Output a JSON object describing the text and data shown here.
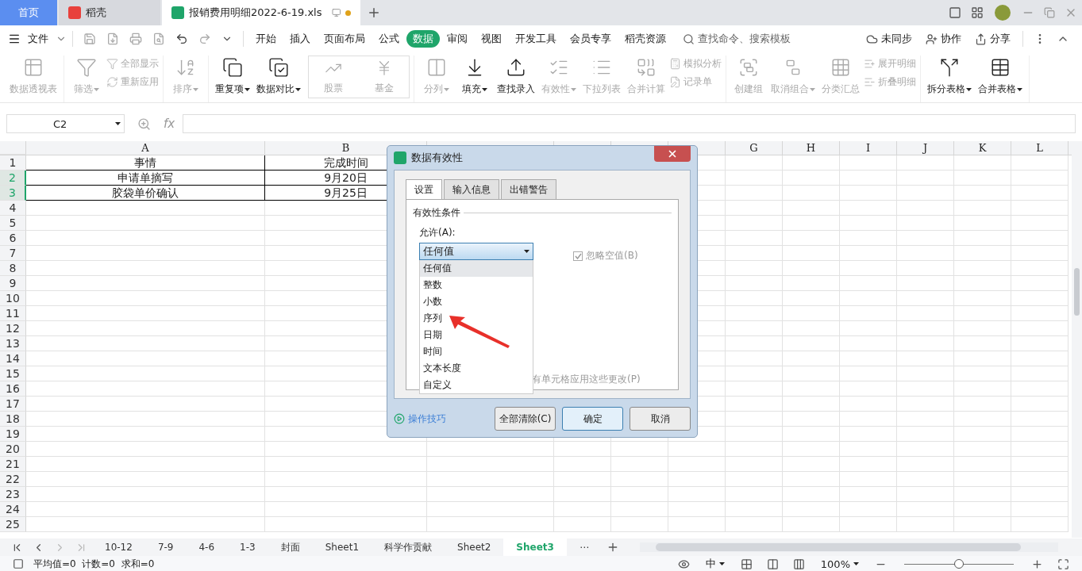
{
  "title_tabs": [
    {
      "label": "首页",
      "kind": "home",
      "selected": false
    },
    {
      "label": "稻壳",
      "kind": "docer",
      "selected": false
    },
    {
      "label": "报销费用明细2022-6-19.xls",
      "kind": "file",
      "selected": true,
      "unsaved": true
    }
  ],
  "menu": {
    "file": "文件",
    "tabs": [
      {
        "label": "开始",
        "selected": false
      },
      {
        "label": "插入",
        "selected": false
      },
      {
        "label": "页面布局",
        "selected": false
      },
      {
        "label": "公式",
        "selected": false
      },
      {
        "label": "数据",
        "selected": true
      },
      {
        "label": "审阅",
        "selected": false
      },
      {
        "label": "视图",
        "selected": false
      },
      {
        "label": "开发工具",
        "selected": false
      },
      {
        "label": "会员专享",
        "selected": false
      },
      {
        "label": "稻壳资源",
        "selected": false
      }
    ],
    "search": {
      "placeholder": "查找命令、搜索模板"
    },
    "actions": [
      "未同步",
      "协作",
      "分享"
    ]
  },
  "ribbon": [
    [
      {
        "kind": "large",
        "label": "数据透视表",
        "disabled": true,
        "dropdown": false
      }
    ],
    [
      {
        "kind": "large",
        "label": "筛选",
        "disabled": true,
        "dropdown": true
      },
      {
        "kind": "small",
        "label": "全部显示",
        "disabled": true
      },
      {
        "kind": "small",
        "label": "重新应用",
        "disabled": true
      }
    ],
    [
      {
        "kind": "large",
        "label": "排序",
        "disabled": true,
        "dropdown": true
      }
    ],
    [
      {
        "kind": "large",
        "label": "重复项",
        "disabled": false,
        "dropdown": true
      },
      {
        "kind": "large",
        "label": "数据对比",
        "disabled": false,
        "dropdown": true
      },
      {
        "kind": "gallery",
        "items": [
          "股票",
          "基金"
        ]
      }
    ],
    [
      {
        "kind": "large",
        "label": "分列",
        "disabled": true,
        "dropdown": true
      },
      {
        "kind": "large",
        "label": "填充",
        "disabled": false,
        "dropdown": true
      },
      {
        "kind": "large",
        "label": "查找录入",
        "disabled": false,
        "dropdown": false
      },
      {
        "kind": "large",
        "label": "有效性",
        "disabled": true,
        "dropdown": true
      },
      {
        "kind": "large",
        "label": "下拉列表",
        "disabled": true,
        "dropdown": false
      },
      {
        "kind": "large",
        "label": "合并计算",
        "disabled": true,
        "dropdown": false
      },
      {
        "kind": "small",
        "label": "模拟分析",
        "disabled": true
      },
      {
        "kind": "small",
        "label": "记录单",
        "disabled": true
      }
    ],
    [
      {
        "kind": "large",
        "label": "创建组",
        "disabled": true,
        "dropdown": false
      },
      {
        "kind": "large",
        "label": "取消组合",
        "disabled": true,
        "dropdown": true
      },
      {
        "kind": "large",
        "label": "分类汇总",
        "disabled": true,
        "dropdown": false
      },
      {
        "kind": "small",
        "label": "展开明细",
        "disabled": true
      },
      {
        "kind": "small",
        "label": "折叠明细",
        "disabled": true
      }
    ],
    [
      {
        "kind": "large",
        "label": "拆分表格",
        "disabled": false,
        "dropdown": true
      },
      {
        "kind": "large",
        "label": "合并表格",
        "disabled": false,
        "dropdown": true
      }
    ]
  ],
  "formula_bar": {
    "name_box": "C2",
    "fx": "fx"
  },
  "columns": [
    {
      "label": "A"
    },
    {
      "label": "B"
    },
    {},
    {},
    {},
    {},
    {
      "label": "G"
    },
    {
      "label": "H"
    },
    {
      "label": "I"
    },
    {
      "label": "J"
    },
    {
      "label": "K"
    },
    {
      "label": "L"
    }
  ],
  "rows": [
    {
      "number": "1",
      "selected": false,
      "cells": [
        "事情",
        "完成时间"
      ]
    },
    {
      "number": "2",
      "selected": true,
      "cells": [
        "申请单摘写",
        "9月20日"
      ]
    },
    {
      "number": "3",
      "selected": true,
      "cells": [
        "胶袋单价确认",
        "9月25日"
      ]
    },
    {
      "number": "4",
      "selected": false
    },
    {
      "number": "5",
      "selected": false
    },
    {
      "number": "6",
      "selected": false
    },
    {
      "number": "7",
      "selected": false
    },
    {
      "number": "8",
      "selected": false
    },
    {
      "number": "9",
      "selected": false
    },
    {
      "number": "10",
      "selected": false
    },
    {
      "number": "11",
      "selected": false
    },
    {
      "number": "12",
      "selected": false
    },
    {
      "number": "13",
      "selected": false
    },
    {
      "number": "14",
      "selected": false
    },
    {
      "number": "15",
      "selected": false
    },
    {
      "number": "16",
      "selected": false
    },
    {
      "number": "17",
      "selected": false
    },
    {
      "number": "18",
      "selected": false
    },
    {
      "number": "19",
      "selected": false
    },
    {
      "number": "20",
      "selected": false
    },
    {
      "number": "21",
      "selected": false
    },
    {
      "number": "22",
      "selected": false
    },
    {
      "number": "23",
      "selected": false
    },
    {
      "number": "24",
      "selected": false
    },
    {
      "number": "25",
      "selected": false
    }
  ],
  "sheets": [
    {
      "label": "10-12",
      "selected": false
    },
    {
      "label": "7-9",
      "selected": false
    },
    {
      "label": "4-6",
      "selected": false
    },
    {
      "label": "1-3",
      "selected": false
    },
    {
      "label": "封面",
      "selected": false
    },
    {
      "label": "Sheet1",
      "selected": false
    },
    {
      "label": "科学作贡献",
      "selected": false
    },
    {
      "label": "Sheet2",
      "selected": false
    },
    {
      "label": "Sheet3",
      "selected": true
    }
  ],
  "more_sheets": "⋯",
  "status_bar": {
    "summary": "平均值=0  计数=0  求和=0",
    "input_mode": "中",
    "zoom": "100%",
    "zoom_slider": {
      "level": 0.5
    }
  },
  "dialog": {
    "title": "数据有效性",
    "tabs": [
      {
        "label": "设置",
        "selected": true
      },
      {
        "label": "输入信息",
        "selected": false
      },
      {
        "label": "出错警告",
        "selected": false
      }
    ],
    "section": "有效性条件",
    "allow_label": "允许(A):",
    "allow_value": "任何值",
    "ignore_blank": {
      "label": "忽略空值(B)",
      "checked": true,
      "disabled": true
    },
    "apply_all": "有单元格应用这些更改(P)",
    "options": [
      {
        "label": "任何值",
        "selected": true
      },
      {
        "label": "整数",
        "selected": false
      },
      {
        "label": "小数",
        "selected": false
      },
      {
        "label": "序列",
        "selected": false
      },
      {
        "label": "日期",
        "selected": false
      },
      {
        "label": "时间",
        "selected": false
      },
      {
        "label": "文本长度",
        "selected": false
      },
      {
        "label": "自定义",
        "selected": false
      }
    ],
    "tips_link": "操作技巧",
    "buttons": [
      {
        "label": "全部清除(C)",
        "default": false
      },
      {
        "label": "确定",
        "default": true
      },
      {
        "label": "取消",
        "default": false
      }
    ]
  }
}
